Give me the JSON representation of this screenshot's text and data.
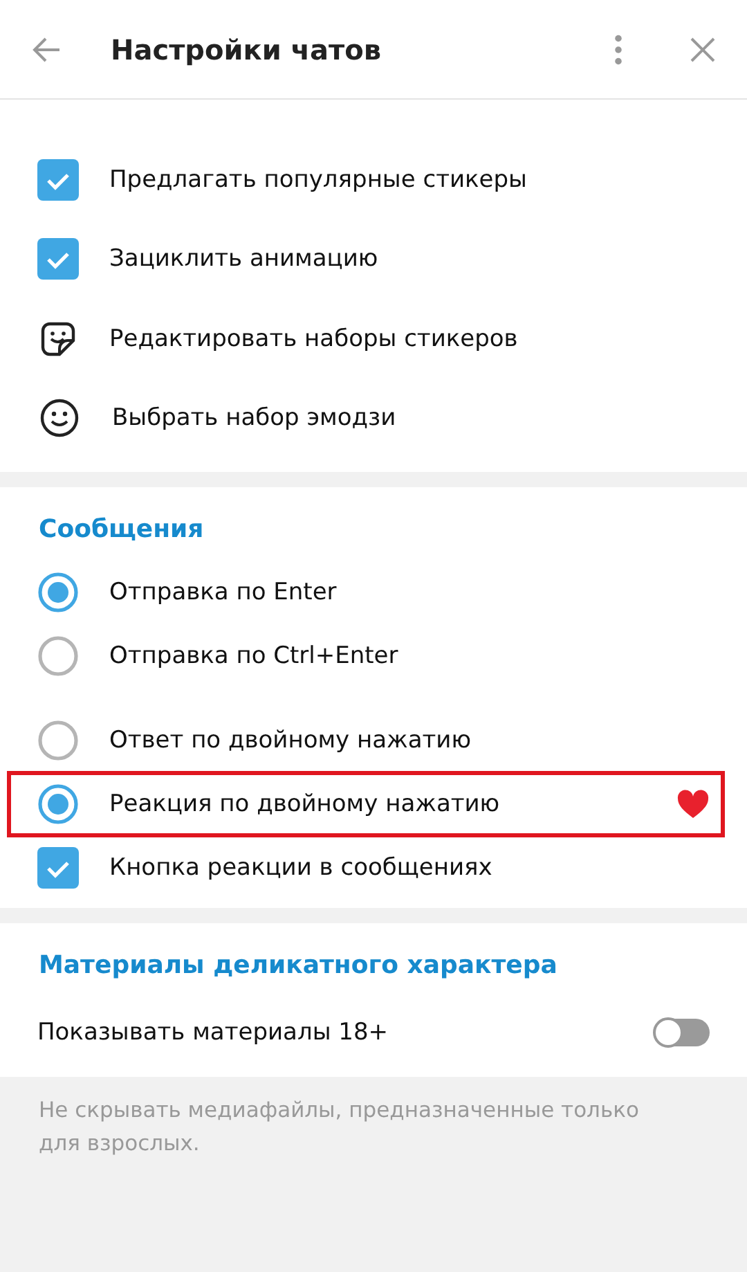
{
  "header": {
    "title": "Настройки чатов"
  },
  "sections": [
    {
      "groups": [
        [
          {
            "kind": "checkbox",
            "label": "Предлагать популярные стикеры",
            "checked": true
          },
          {
            "kind": "checkbox",
            "label": "Зациклить анимацию",
            "checked": true
          },
          {
            "kind": "sticker_link",
            "label": "Редактировать наборы стикеров"
          },
          {
            "kind": "emoji_link",
            "label": "Выбрать набор эмодзи"
          }
        ]
      ]
    },
    {
      "title": "Сообщения",
      "groups": [
        [
          {
            "kind": "radio",
            "label": "Отправка по Enter",
            "selected": true
          },
          {
            "kind": "radio",
            "label": "Отправка по Ctrl+Enter",
            "selected": false
          }
        ],
        [
          {
            "kind": "radio",
            "label": "Ответ по двойному нажатию",
            "selected": false
          },
          {
            "kind": "radio",
            "label": "Реакция по двойному нажатию",
            "selected": true,
            "highlighted": true,
            "has_reaction": true
          },
          {
            "kind": "checkbox",
            "label": "Кнопка реакции в сообщениях",
            "checked": true
          }
        ]
      ]
    },
    {
      "title": "Материалы деликатного характера",
      "groups": [
        [
          {
            "kind": "toggle",
            "label": "Показывать материалы 18+",
            "on": false
          }
        ]
      ]
    }
  ],
  "footer_note": "Не скрывать медиафайлы, предназначенные только для взрослых."
}
